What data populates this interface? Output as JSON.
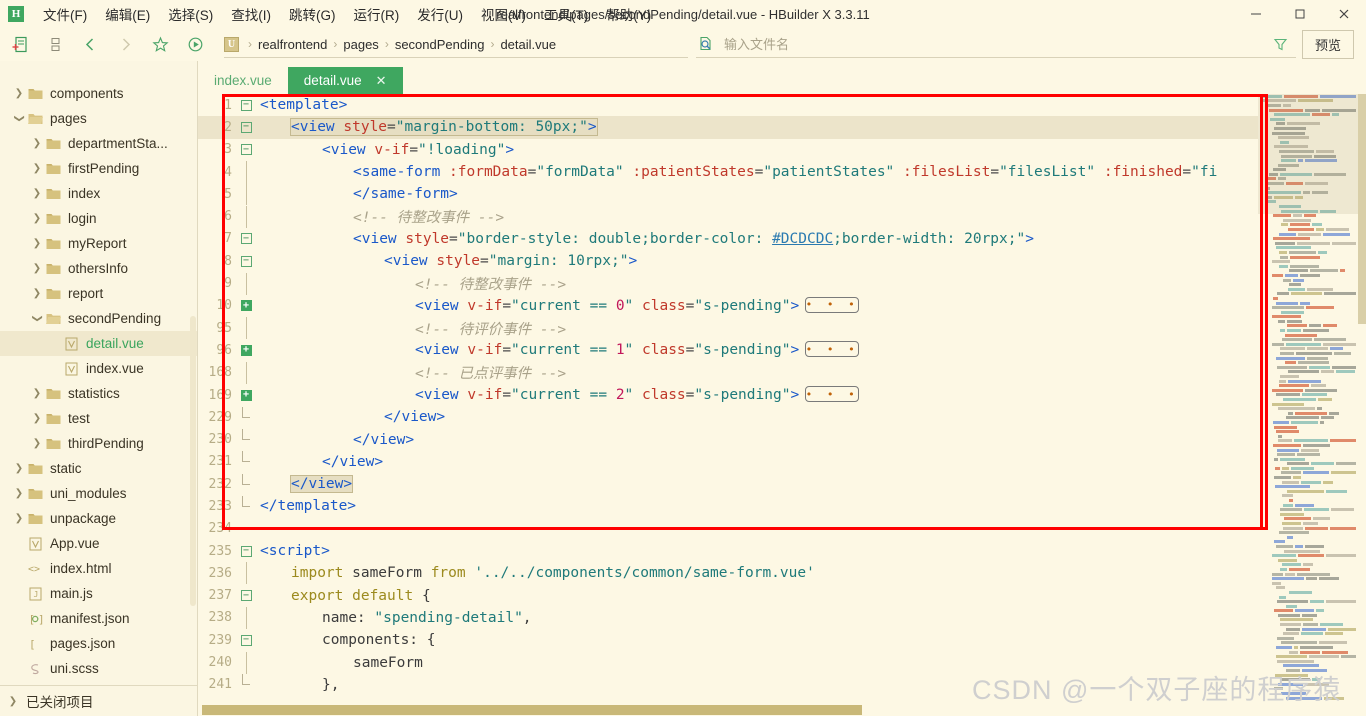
{
  "window": {
    "app_logo": "H",
    "title": "realfrontend/pages/secondPending/detail.vue - HBuilder X 3.3.11",
    "minimize": "─",
    "maximize": "❐",
    "close": "✕"
  },
  "menubar": {
    "items": [
      {
        "label": "文件(F)",
        "name": "menu-file"
      },
      {
        "label": "编辑(E)",
        "name": "menu-edit"
      },
      {
        "label": "选择(S)",
        "name": "menu-select"
      },
      {
        "label": "查找(I)",
        "name": "menu-find"
      },
      {
        "label": "跳转(G)",
        "name": "menu-goto"
      },
      {
        "label": "运行(R)",
        "name": "menu-run"
      },
      {
        "label": "发行(U)",
        "name": "menu-publish"
      },
      {
        "label": "视图(V)",
        "name": "menu-view"
      },
      {
        "label": "工具(T)",
        "name": "menu-tools"
      },
      {
        "label": "帮助(Y)",
        "name": "menu-help"
      }
    ]
  },
  "toolbar": {
    "icons": [
      "new-file-icon",
      "save-icon",
      "back-icon",
      "forward-icon",
      "favorite-icon",
      "run-icon"
    ],
    "breadcrumb": {
      "badge": "U",
      "segments": [
        "realfrontend",
        "pages",
        "secondPending",
        "detail.vue"
      ],
      "separator": "›"
    },
    "file_search_placeholder": "输入文件名",
    "file_search_value": "",
    "preview_label": "预览"
  },
  "sidebar": {
    "items": [
      {
        "label": "components",
        "indent": 0,
        "type": "folder",
        "state": "collapsed"
      },
      {
        "label": "pages",
        "indent": 0,
        "type": "folder",
        "state": "expanded"
      },
      {
        "label": "departmentSta...",
        "indent": 1,
        "type": "folder",
        "state": "collapsed"
      },
      {
        "label": "firstPending",
        "indent": 1,
        "type": "folder",
        "state": "collapsed"
      },
      {
        "label": "index",
        "indent": 1,
        "type": "folder",
        "state": "collapsed"
      },
      {
        "label": "login",
        "indent": 1,
        "type": "folder",
        "state": "collapsed"
      },
      {
        "label": "myReport",
        "indent": 1,
        "type": "folder",
        "state": "collapsed"
      },
      {
        "label": "othersInfo",
        "indent": 1,
        "type": "folder",
        "state": "collapsed"
      },
      {
        "label": "report",
        "indent": 1,
        "type": "folder",
        "state": "collapsed"
      },
      {
        "label": "secondPending",
        "indent": 1,
        "type": "folder",
        "state": "expanded"
      },
      {
        "label": "detail.vue",
        "indent": 2,
        "type": "vue",
        "state": "none",
        "selected": true
      },
      {
        "label": "index.vue",
        "indent": 2,
        "type": "vue",
        "state": "none"
      },
      {
        "label": "statistics",
        "indent": 1,
        "type": "folder",
        "state": "collapsed"
      },
      {
        "label": "test",
        "indent": 1,
        "type": "folder",
        "state": "collapsed"
      },
      {
        "label": "thirdPending",
        "indent": 1,
        "type": "folder",
        "state": "collapsed"
      },
      {
        "label": "static",
        "indent": 0,
        "type": "folder",
        "state": "collapsed"
      },
      {
        "label": "uni_modules",
        "indent": 0,
        "type": "folder",
        "state": "collapsed"
      },
      {
        "label": "unpackage",
        "indent": 0,
        "type": "folder",
        "state": "collapsed"
      },
      {
        "label": "App.vue",
        "indent": 0,
        "type": "vue",
        "state": "none"
      },
      {
        "label": "index.html",
        "indent": 0,
        "type": "html",
        "state": "none"
      },
      {
        "label": "main.js",
        "indent": 0,
        "type": "js",
        "state": "none"
      },
      {
        "label": "manifest.json",
        "indent": 0,
        "type": "manifest",
        "state": "none"
      },
      {
        "label": "pages.json",
        "indent": 0,
        "type": "json",
        "state": "none"
      },
      {
        "label": "uni.scss",
        "indent": 0,
        "type": "scss",
        "state": "none"
      }
    ],
    "closed_projects_label": "已关闭项目"
  },
  "tabs": [
    {
      "label": "index.vue",
      "active": false,
      "closable": false
    },
    {
      "label": "detail.vue",
      "active": true,
      "closable": true,
      "close_glyph": "✕"
    }
  ],
  "editor": {
    "lines": [
      {
        "num": "1",
        "fold": "minus",
        "indent": 0,
        "tokens": [
          {
            "t": "tag",
            "v": "<template>"
          }
        ]
      },
      {
        "num": "2",
        "fold": "minus",
        "indent": 1,
        "highlight": true,
        "selected": true,
        "tokens": [
          {
            "t": "tag",
            "v": "<view "
          },
          {
            "t": "attr",
            "v": "style"
          },
          {
            "t": "punc",
            "v": "="
          },
          {
            "t": "str",
            "v": "\"margin-bottom: 50px;\""
          },
          {
            "t": "tag",
            "v": ">"
          }
        ]
      },
      {
        "num": "3",
        "fold": "minus",
        "indent": 2,
        "tokens": [
          {
            "t": "tag",
            "v": "<view "
          },
          {
            "t": "attr",
            "v": "v-if"
          },
          {
            "t": "punc",
            "v": "="
          },
          {
            "t": "str",
            "v": "\"!loading\""
          },
          {
            "t": "tag",
            "v": ">"
          }
        ]
      },
      {
        "num": "4",
        "fold": "bar",
        "indent": 3,
        "tokens": [
          {
            "t": "tag",
            "v": "<same-form "
          },
          {
            "t": "attr",
            "v": ":formData"
          },
          {
            "t": "punc",
            "v": "="
          },
          {
            "t": "str",
            "v": "\"formData\""
          },
          {
            "t": "plain",
            "v": " "
          },
          {
            "t": "attr",
            "v": ":patientStates"
          },
          {
            "t": "punc",
            "v": "="
          },
          {
            "t": "str",
            "v": "\"patientStates\""
          },
          {
            "t": "plain",
            "v": " "
          },
          {
            "t": "attr",
            "v": ":filesList"
          },
          {
            "t": "punc",
            "v": "="
          },
          {
            "t": "str",
            "v": "\"filesList\""
          },
          {
            "t": "plain",
            "v": " "
          },
          {
            "t": "attr",
            "v": ":finished"
          },
          {
            "t": "punc",
            "v": "="
          },
          {
            "t": "str",
            "v": "\"fi"
          }
        ]
      },
      {
        "num": "5",
        "fold": "bar",
        "indent": 3,
        "tokens": [
          {
            "t": "tag",
            "v": "</same-form>"
          }
        ]
      },
      {
        "num": "6",
        "fold": "bar",
        "indent": 3,
        "tokens": [
          {
            "t": "cmt",
            "v": "<!-- 待整改事件 -->"
          }
        ]
      },
      {
        "num": "7",
        "fold": "minus",
        "indent": 3,
        "tokens": [
          {
            "t": "tag",
            "v": "<view "
          },
          {
            "t": "attr",
            "v": "style"
          },
          {
            "t": "punc",
            "v": "="
          },
          {
            "t": "str",
            "v": "\"border-style: double;border-color: "
          },
          {
            "t": "link",
            "v": "#DCDCDC"
          },
          {
            "t": "str",
            "v": ";border-width: 20rpx;\""
          },
          {
            "t": "tag",
            "v": ">"
          }
        ]
      },
      {
        "num": "8",
        "fold": "minus",
        "indent": 4,
        "tokens": [
          {
            "t": "tag",
            "v": "<view "
          },
          {
            "t": "attr",
            "v": "style"
          },
          {
            "t": "punc",
            "v": "="
          },
          {
            "t": "str",
            "v": "\"margin: 10rpx;\""
          },
          {
            "t": "tag",
            "v": ">"
          }
        ]
      },
      {
        "num": "9",
        "fold": "bar",
        "indent": 5,
        "tokens": [
          {
            "t": "cmt",
            "v": "<!-- 待整改事件 -->"
          }
        ]
      },
      {
        "num": "10",
        "fold": "plus",
        "indent": 5,
        "folded": true,
        "tokens": [
          {
            "t": "tag",
            "v": "<view "
          },
          {
            "t": "attr",
            "v": "v-if"
          },
          {
            "t": "punc",
            "v": "="
          },
          {
            "t": "str",
            "v": "\"current == "
          },
          {
            "t": "num",
            "v": "0"
          },
          {
            "t": "str",
            "v": "\""
          },
          {
            "t": "plain",
            "v": " "
          },
          {
            "t": "attr",
            "v": "class"
          },
          {
            "t": "punc",
            "v": "="
          },
          {
            "t": "str",
            "v": "\"s-pending\""
          },
          {
            "t": "tag",
            "v": ">"
          }
        ]
      },
      {
        "num": "95",
        "fold": "bar",
        "indent": 5,
        "tokens": [
          {
            "t": "cmt",
            "v": "<!-- 待评价事件 -->"
          }
        ]
      },
      {
        "num": "96",
        "fold": "plus",
        "indent": 5,
        "folded": true,
        "tokens": [
          {
            "t": "tag",
            "v": "<view "
          },
          {
            "t": "attr",
            "v": "v-if"
          },
          {
            "t": "punc",
            "v": "="
          },
          {
            "t": "str",
            "v": "\"current == "
          },
          {
            "t": "num",
            "v": "1"
          },
          {
            "t": "str",
            "v": "\""
          },
          {
            "t": "plain",
            "v": " "
          },
          {
            "t": "attr",
            "v": "class"
          },
          {
            "t": "punc",
            "v": "="
          },
          {
            "t": "str",
            "v": "\"s-pending\""
          },
          {
            "t": "tag",
            "v": ">"
          }
        ]
      },
      {
        "num": "168",
        "fold": "bar",
        "indent": 5,
        "tokens": [
          {
            "t": "cmt",
            "v": "<!-- 已点评事件 -->"
          }
        ]
      },
      {
        "num": "169",
        "fold": "plus",
        "indent": 5,
        "folded": true,
        "tokens": [
          {
            "t": "tag",
            "v": "<view "
          },
          {
            "t": "attr",
            "v": "v-if"
          },
          {
            "t": "punc",
            "v": "="
          },
          {
            "t": "str",
            "v": "\"current == "
          },
          {
            "t": "num",
            "v": "2"
          },
          {
            "t": "str",
            "v": "\""
          },
          {
            "t": "plain",
            "v": " "
          },
          {
            "t": "attr",
            "v": "class"
          },
          {
            "t": "punc",
            "v": "="
          },
          {
            "t": "str",
            "v": "\"s-pending\""
          },
          {
            "t": "tag",
            "v": ">"
          }
        ]
      },
      {
        "num": "229",
        "fold": "end",
        "indent": 4,
        "tokens": [
          {
            "t": "tag",
            "v": "</view>"
          }
        ]
      },
      {
        "num": "230",
        "fold": "end",
        "indent": 3,
        "tokens": [
          {
            "t": "tag",
            "v": "</view>"
          }
        ]
      },
      {
        "num": "231",
        "fold": "end",
        "indent": 2,
        "tokens": [
          {
            "t": "tag",
            "v": "</view>"
          }
        ]
      },
      {
        "num": "232",
        "fold": "end",
        "indent": 1,
        "boxed": true,
        "tokens": [
          {
            "t": "tag",
            "v": "</view>"
          }
        ]
      },
      {
        "num": "233",
        "fold": "end",
        "indent": 0,
        "tokens": [
          {
            "t": "tag",
            "v": "</template>"
          }
        ]
      },
      {
        "num": "234",
        "fold": "none",
        "indent": 0,
        "tokens": []
      },
      {
        "num": "235",
        "fold": "minus",
        "indent": 0,
        "tokens": [
          {
            "t": "tag",
            "v": "<script>"
          }
        ]
      },
      {
        "num": "236",
        "fold": "bar",
        "indent": 1,
        "tokens": [
          {
            "t": "kw",
            "v": "import"
          },
          {
            "t": "plain",
            "v": " sameForm "
          },
          {
            "t": "kw",
            "v": "from"
          },
          {
            "t": "plain",
            "v": " "
          },
          {
            "t": "str",
            "v": "'../../components/common/same-form.vue'"
          }
        ]
      },
      {
        "num": "237",
        "fold": "minus",
        "indent": 1,
        "tokens": [
          {
            "t": "kw",
            "v": "export default"
          },
          {
            "t": "plain",
            "v": " {"
          }
        ]
      },
      {
        "num": "238",
        "fold": "bar",
        "indent": 2,
        "tokens": [
          {
            "t": "plain",
            "v": "name: "
          },
          {
            "t": "str",
            "v": "\"spending-detail\""
          },
          {
            "t": "plain",
            "v": ","
          }
        ]
      },
      {
        "num": "239",
        "fold": "minus",
        "indent": 2,
        "tokens": [
          {
            "t": "plain",
            "v": "components: {"
          }
        ]
      },
      {
        "num": "240",
        "fold": "bar",
        "indent": 3,
        "tokens": [
          {
            "t": "plain",
            "v": "sameForm"
          }
        ]
      },
      {
        "num": "241",
        "fold": "end",
        "indent": 2,
        "tokens": [
          {
            "t": "plain",
            "v": "},"
          }
        ]
      }
    ],
    "folded_placeholder": "• • •"
  },
  "watermark": "CSDN @一个双子座的程序猿",
  "colors": {
    "accent_green": "#3fa760",
    "editor_bg": "#fdf8e4",
    "sidebar_bg": "#fbf6e2",
    "annotation_red": "#ff0000",
    "tag_blue": "#1a58c9",
    "attr_red": "#c0392b",
    "string_teal": "#1f7a7a",
    "comment_gray": "#a9a28a"
  }
}
